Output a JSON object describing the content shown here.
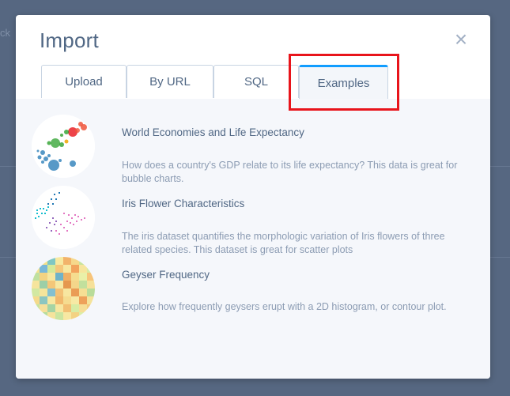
{
  "background": {
    "partial_text": "ck"
  },
  "modal": {
    "title": "Import",
    "close_icon": "close-icon",
    "tabs": [
      {
        "label": "Upload",
        "active": false
      },
      {
        "label": "By URL",
        "active": false
      },
      {
        "label": "SQL",
        "active": false
      },
      {
        "label": "Examples",
        "active": true
      }
    ],
    "accent_color": "#119dff",
    "highlight_color": "#e8141b"
  },
  "examples": [
    {
      "title": "World Economies and Life Expectancy",
      "description": "How does a country's GDP relate to its life expectancy? This data is great for bubble charts.",
      "thumbnail": "bubble-chart-thumbnail"
    },
    {
      "title": "Iris Flower Characteristics",
      "description": "The iris dataset quantifies the morphologic variation of Iris flowers of three related species. This dataset is great for scatter plots",
      "thumbnail": "scatter-plot-thumbnail"
    },
    {
      "title": "Geyser Frequency",
      "description": "Explore how frequently geysers erupt with a 2D histogram, or contour plot.",
      "thumbnail": "histogram-2d-thumbnail"
    }
  ]
}
